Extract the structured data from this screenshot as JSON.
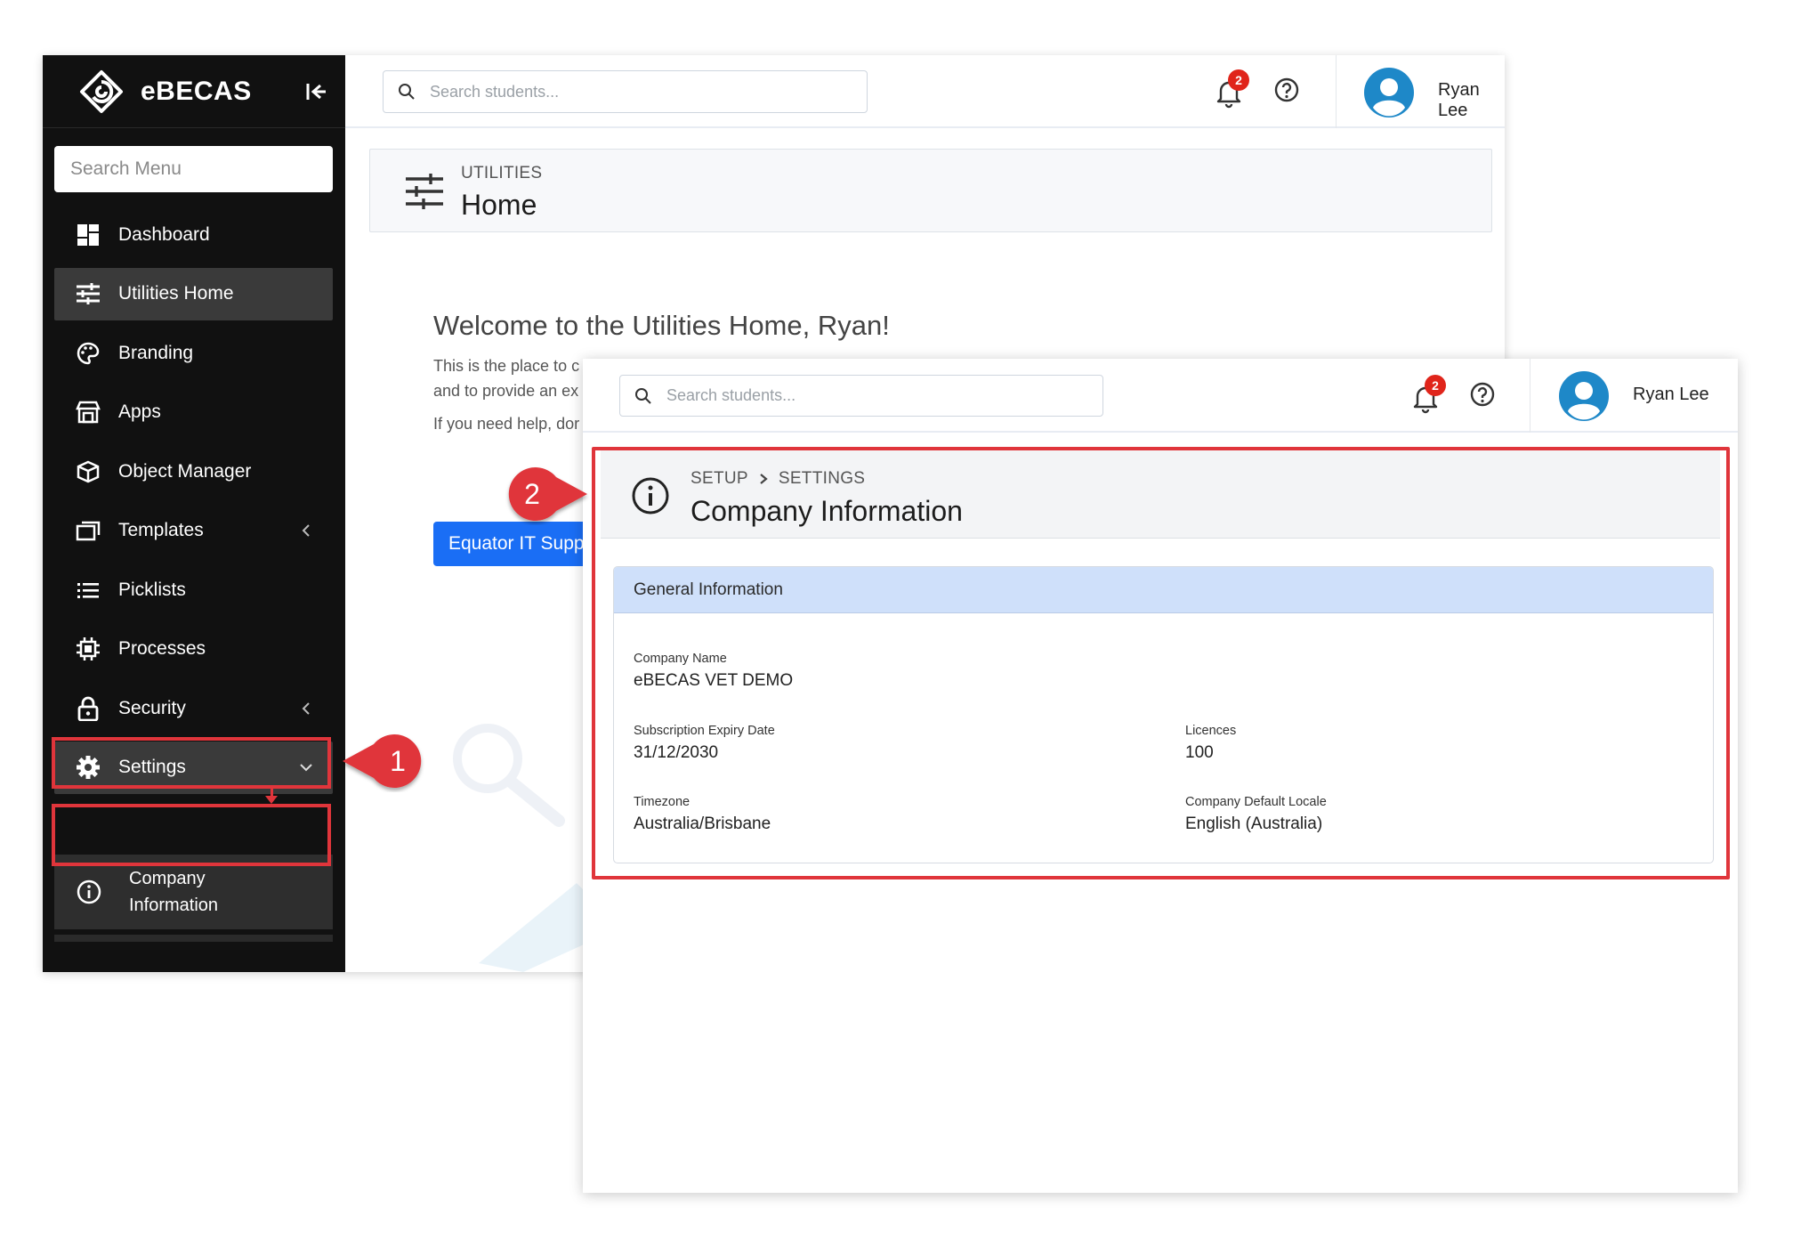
{
  "app": {
    "brand_name": "eBECAS",
    "menu_search_placeholder": "Search Menu",
    "student_search_placeholder": "Search students...",
    "notification_count": "2",
    "user_name": "Ryan Lee"
  },
  "sidebar": {
    "items": [
      {
        "label": "Dashboard"
      },
      {
        "label": "Utilities Home"
      },
      {
        "label": "Branding"
      },
      {
        "label": "Apps"
      },
      {
        "label": "Object Manager"
      },
      {
        "label": "Templates"
      },
      {
        "label": "Picklists"
      },
      {
        "label": "Processes"
      },
      {
        "label": "Security"
      },
      {
        "label": "Settings"
      }
    ],
    "submenu": {
      "line1": "Company",
      "line2": "Information"
    }
  },
  "utilities_page": {
    "header_sub": "UTILITIES",
    "header_title": "Home",
    "welcome": "Welcome to the Utilities Home, Ryan!",
    "para1_line1": "This is the place to c",
    "para1_line2": "and to provide an ex",
    "para2": "If you need help, dor",
    "button_label": "Equator IT Supp"
  },
  "company_page": {
    "breadcrumb": [
      "SETUP",
      "SETTINGS"
    ],
    "title": "Company Information",
    "card_title": "General Information",
    "fields": {
      "company_name": {
        "label": "Company Name",
        "value": "eBECAS VET DEMO"
      },
      "subscription_expiry": {
        "label": "Subscription Expiry Date",
        "value": "31/12/2030"
      },
      "licences": {
        "label": "Licences",
        "value": "100"
      },
      "timezone": {
        "label": "Timezone",
        "value": "Australia/Brisbane"
      },
      "default_locale": {
        "label": "Company Default Locale",
        "value": "English (Australia)"
      }
    }
  },
  "callouts": {
    "step1": "1",
    "step2": "2"
  },
  "colors": {
    "sidebar_bg": "#111111",
    "active_item_bg": "#3a3a3a",
    "primary_button": "#1a6ef5",
    "badge_red": "#e0251b",
    "highlight_red": "#e0353b",
    "card_header_blue": "#cfe0fa",
    "avatar_blue": "#1e88c8"
  }
}
